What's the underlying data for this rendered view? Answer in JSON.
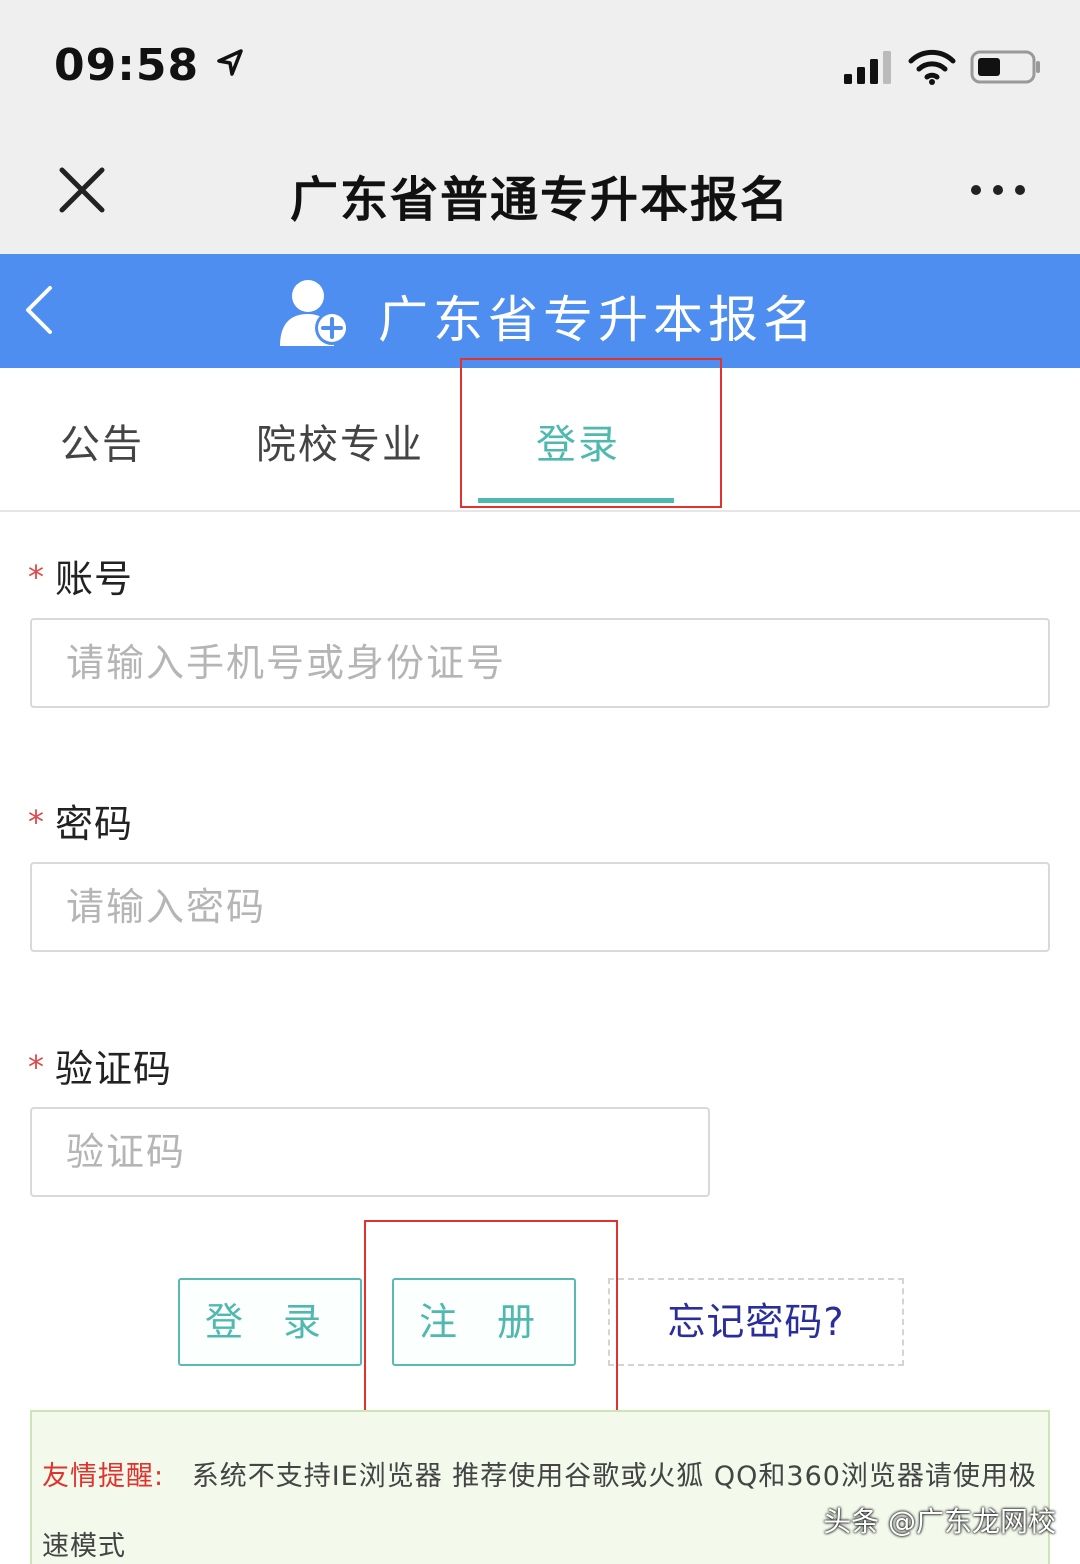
{
  "status_bar": {
    "time": "09:58"
  },
  "wechat_header": {
    "title": "广东省普通专升本报名"
  },
  "app_header": {
    "title": "广东省专升本报名"
  },
  "tabs": [
    {
      "label": "公告",
      "active": false
    },
    {
      "label": "院校专业",
      "active": false
    },
    {
      "label": "登录",
      "active": true
    }
  ],
  "form": {
    "required_mark": "*",
    "account": {
      "label": "账号",
      "placeholder": "请输入手机号或身份证号",
      "value": ""
    },
    "password": {
      "label": "密码",
      "placeholder": "请输入密码",
      "value": ""
    },
    "captcha": {
      "label": "验证码",
      "placeholder": "验证码",
      "value": ""
    }
  },
  "actions": {
    "login_label": "登 录",
    "register_label": "注 册",
    "forgot_label": "忘记密码?"
  },
  "notice": {
    "title": "友情提醒:",
    "text": "系统不支持IE浏览器 推荐使用谷歌或火狐 QQ和360浏览器请使用极速模式"
  },
  "watermark": "头条 @广东龙网校",
  "colors": {
    "header_blue": "#4e8ef0",
    "accent_teal": "#4fb9b0",
    "annotation_red": "#e0332d",
    "link_navy": "#2a2e9a",
    "notice_bg": "#f3faec"
  },
  "icons": [
    "location-arrow-icon",
    "signal-icon",
    "wifi-icon",
    "battery-icon",
    "close-icon",
    "more-icon",
    "back-chevron-icon",
    "user-add-icon"
  ]
}
